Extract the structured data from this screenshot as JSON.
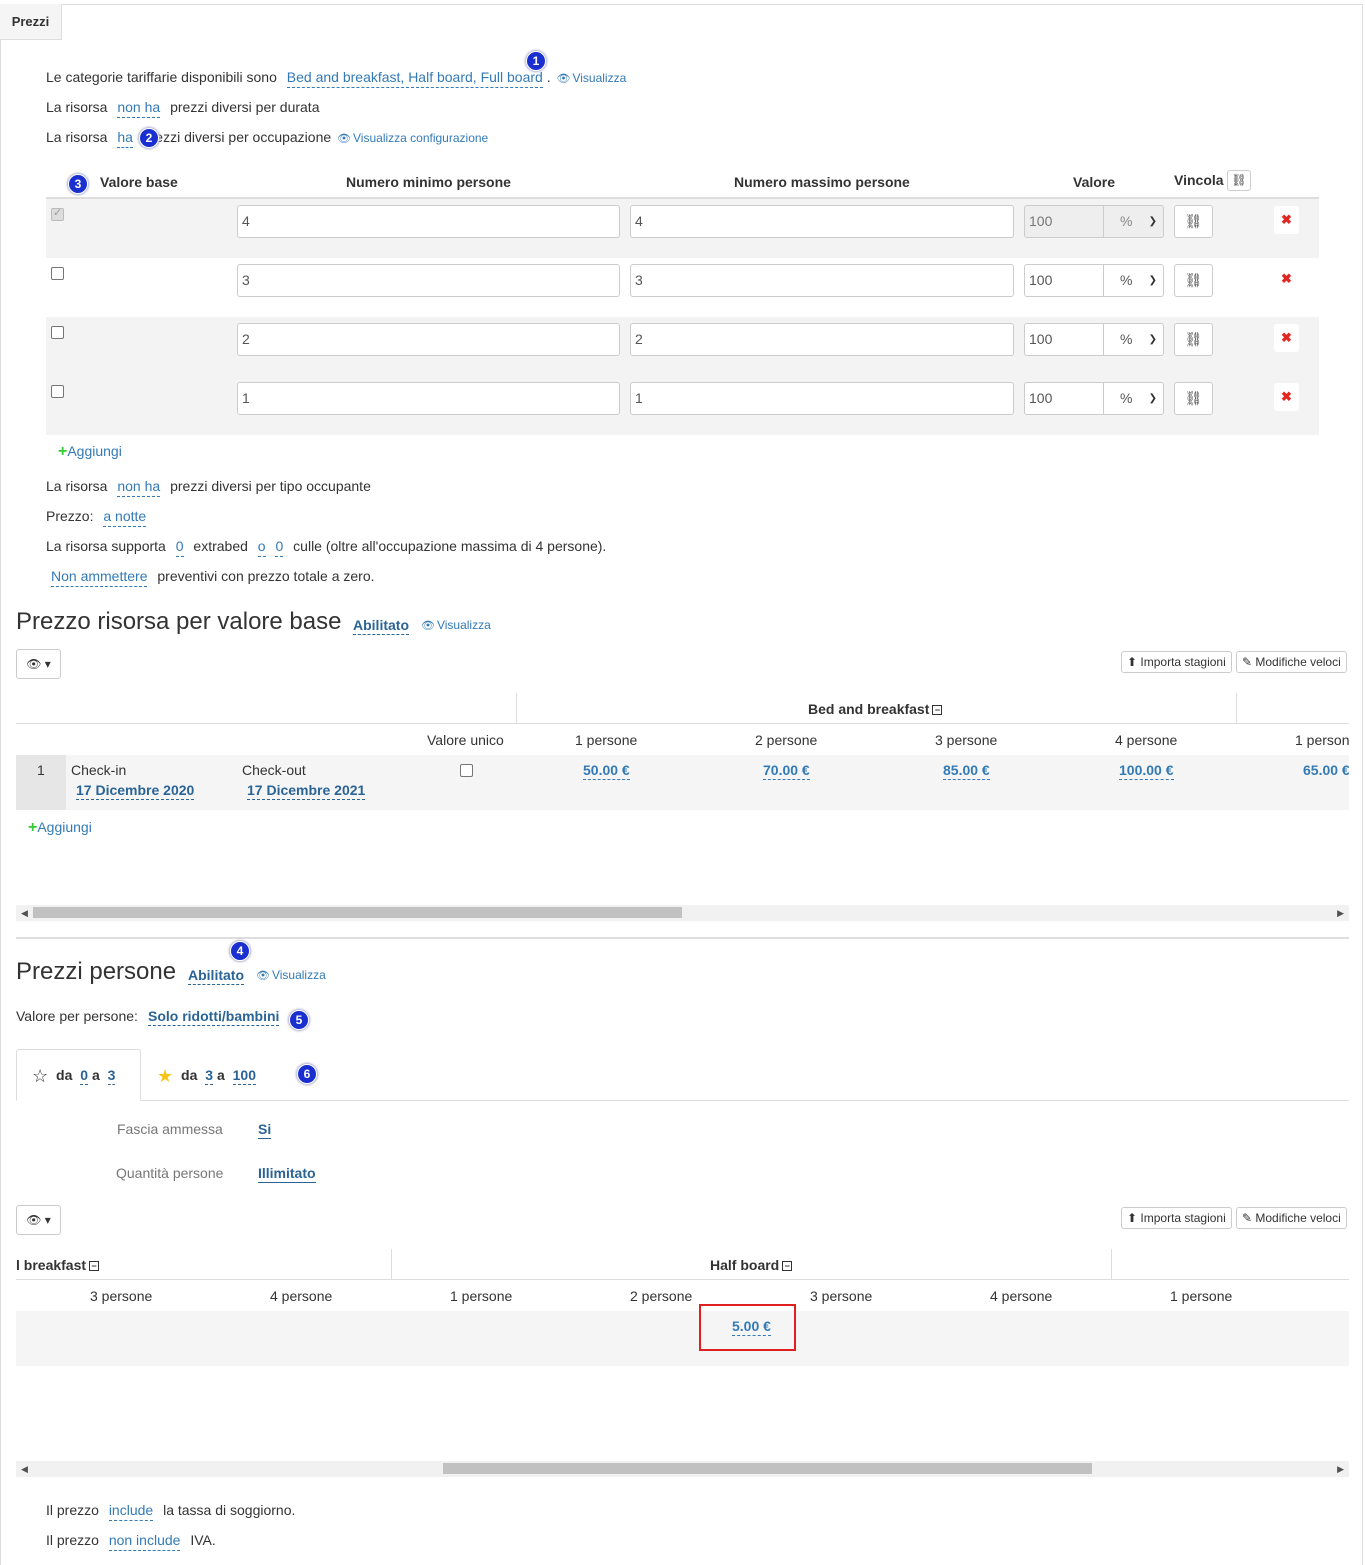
{
  "tab": {
    "label": "Prezzi"
  },
  "settings": {
    "categories_prefix": "Le categorie tariffarie disponibili sono",
    "categories_value": "Bed and breakfast, Half board, Full board",
    "categories_suffix": ".",
    "view_label": "Visualizza",
    "duration_prefix": "La risorsa",
    "duration_value": "non ha",
    "duration_suffix": "prezzi diversi per durata",
    "occupancy_prefix": "La risorsa",
    "occupancy_value": "ha",
    "occupancy_suffix": "prezzi diversi per occupazione",
    "view_config_label": "Visualizza configurazione"
  },
  "badges": [
    "1",
    "2",
    "3",
    "4",
    "5",
    "6"
  ],
  "occupancy_table": {
    "headers": {
      "base": "Valore base",
      "min": "Numero minimo persone",
      "max": "Numero massimo persone",
      "value": "Valore",
      "bind": "Vincola"
    },
    "rows": [
      {
        "base_checked": true,
        "min": "4",
        "max": "4",
        "value": "100",
        "unit": "%"
      },
      {
        "base_checked": false,
        "min": "3",
        "max": "3",
        "value": "100",
        "unit": "%"
      },
      {
        "base_checked": false,
        "min": "2",
        "max": "2",
        "value": "100",
        "unit": "%"
      },
      {
        "base_checked": false,
        "min": "1",
        "max": "1",
        "value": "100",
        "unit": "%"
      }
    ],
    "add_label": "Aggiungi"
  },
  "more_settings": {
    "occupant_prefix": "La risorsa",
    "occupant_value": "non ha",
    "occupant_suffix": "prezzi diversi per tipo occupante",
    "price_prefix": "Prezzo:",
    "price_value": "a notte",
    "extrabed_prefix": "La risorsa supporta",
    "extrabed_value": "0",
    "extrabed_mid": "extrabed",
    "extrabed_conj": "o",
    "cribs_value": "0",
    "cribs_suffix": "culle (oltre all'occupazione massima di 4 persone).",
    "zero_value": "Non ammettere",
    "zero_suffix": "preventivi con prezzo totale a zero."
  },
  "base_price": {
    "title": "Prezzo risorsa per valore base",
    "status": "Abilitato",
    "view_label": "Visualizza",
    "import_label": "Importa stagioni",
    "quick_edit_label": "Modifiche veloci",
    "category": "Bed and breakfast",
    "single_value_label": "Valore unico",
    "columns": [
      "1 persone",
      "2 persone",
      "3 persone",
      "4 persone",
      "1 person"
    ],
    "row": {
      "index": "1",
      "checkin_label": "Check-in",
      "checkin_date": "17 Dicembre 2020",
      "checkout_label": "Check-out",
      "checkout_date": "17 Dicembre 2021",
      "prices": [
        "50.00 €",
        "70.00 €",
        "85.00 €",
        "100.00 €",
        "65.00 €"
      ]
    },
    "add_label": "Aggiungi"
  },
  "person_prices": {
    "title": "Prezzi persone",
    "status": "Abilitato",
    "view_label": "Visualizza",
    "value_for_label": "Valore per persone:",
    "value_for_value": "Solo ridotti/bambini",
    "tabs": [
      {
        "prefix": "da",
        "from": "0",
        "mid": "a",
        "to": "3"
      },
      {
        "prefix": "da",
        "from": "3",
        "mid": "a",
        "to": "100"
      }
    ],
    "band_allowed_label": "Fascia ammessa",
    "band_allowed_value": "Si",
    "quantity_label": "Quantità persone",
    "quantity_value": "Illimitato",
    "import_label": "Importa stagioni",
    "quick_edit_label": "Modifiche veloci",
    "category_left": "l breakfast",
    "category_mid": "Half board",
    "columns": [
      "3 persone",
      "4 persone",
      "1 persone",
      "2 persone",
      "3 persone",
      "4 persone",
      "1 persone"
    ],
    "highlighted_price": "5.00 €"
  },
  "footer": {
    "tax_prefix": "Il prezzo",
    "tax_value": "include",
    "tax_suffix": "la tassa di soggiorno.",
    "vat_prefix": "Il prezzo",
    "vat_value": "non include",
    "vat_suffix": "IVA."
  },
  "colors": {
    "link": "#337ab7",
    "badge": "#1a2fd0",
    "delete": "#e3261f",
    "add": "#33cc33",
    "highlight": "#e02020"
  }
}
